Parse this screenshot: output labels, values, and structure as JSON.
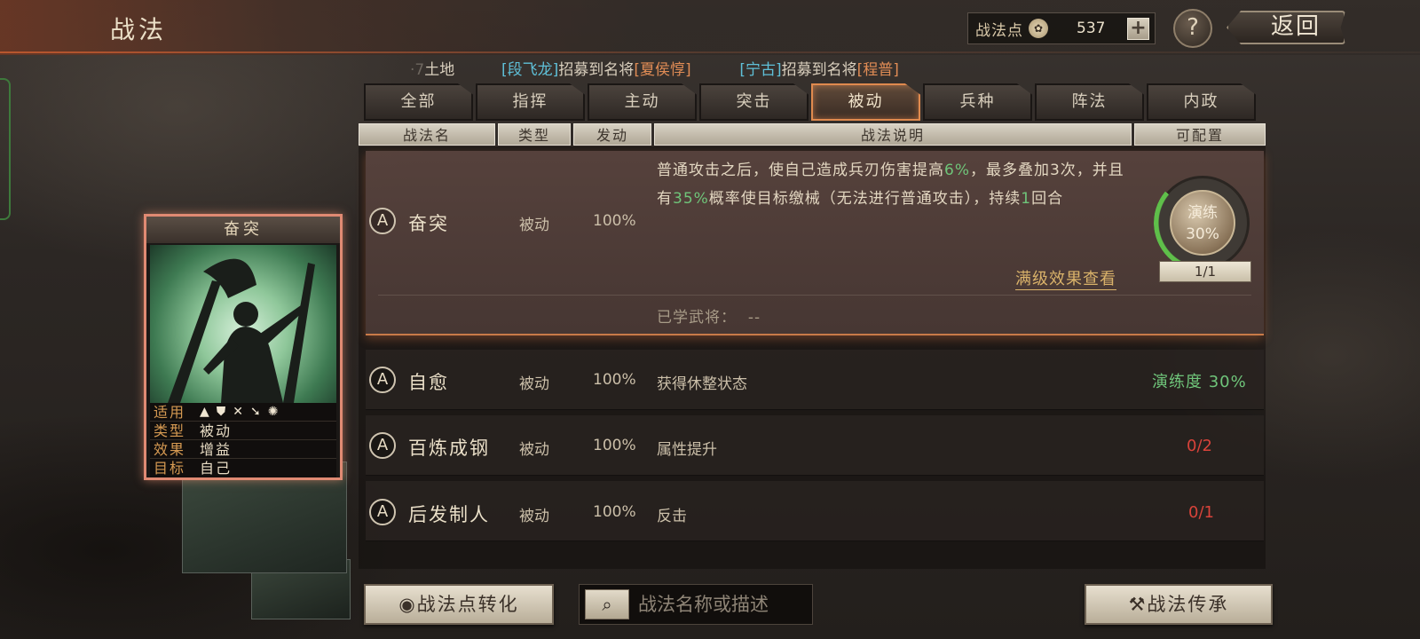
{
  "header": {
    "title": "战法",
    "points_label": "战法点",
    "points_value": "537",
    "plus": "+",
    "help": "?",
    "back": "返回"
  },
  "ticker": {
    "prefix": "·7",
    "prefix_rest": "土地",
    "item1_name": "[段飞龙]",
    "item1_text": "招募到名将",
    "item1_target": "[夏侯惇]",
    "item2_name": "[宁古]",
    "item2_text": "招募到名将",
    "item2_target": "[程普]"
  },
  "tabs": [
    "全部",
    "指挥",
    "主动",
    "突击",
    "被动",
    "兵种",
    "阵法",
    "内政"
  ],
  "active_tab": "被动",
  "columns": {
    "name": "战法名",
    "type": "类型",
    "trigger": "发动",
    "desc": "战法说明",
    "config": "可配置"
  },
  "selected": {
    "grade": "A",
    "name": "奋突",
    "type": "被动",
    "rate": "100%",
    "desc_1": "普通攻击之后，使自己造成兵刃伤害提高",
    "desc_hl1": "6%",
    "desc_2": "，最多叠加3次，并且有",
    "desc_hl2": "35%",
    "desc_3": "概率使目标缴械（无法进行普通攻击），持续",
    "desc_hl3": "1",
    "desc_4": "回合",
    "full_link": "满级效果查看",
    "learned_label": "已学武将：",
    "learned_value": "--",
    "drill_label": "演练",
    "drill_pct": "30%",
    "slots": "1/1"
  },
  "rows": [
    {
      "grade": "A",
      "name": "自愈",
      "type": "被动",
      "rate": "100%",
      "desc": "获得休整状态",
      "config": "演练度 30%"
    },
    {
      "grade": "A",
      "name": "百炼成钢",
      "type": "被动",
      "rate": "100%",
      "desc": "属性提升",
      "config": "0/2"
    },
    {
      "grade": "A",
      "name": "后发制人",
      "type": "被动",
      "rate": "100%",
      "desc": "反击",
      "config": "0/1"
    }
  ],
  "card": {
    "title": "奋突",
    "k_apply": "适用",
    "k_type": "类型",
    "v_type": "被动",
    "k_effect": "效果",
    "v_effect": "增益",
    "k_target": "目标",
    "v_target": "自己",
    "unit_icons": [
      "cavalry-icon",
      "shield-icon",
      "bow-icon",
      "spear-icon",
      "wheel-icon"
    ]
  },
  "footer": {
    "convert": "战法点转化",
    "search_placeholder": "战法名称或描述",
    "inherit": "战法传承"
  },
  "colors": {
    "accent": "#e08a4e",
    "green": "#6fc57a",
    "red": "#d8433a",
    "gold": "#d9b26a"
  }
}
